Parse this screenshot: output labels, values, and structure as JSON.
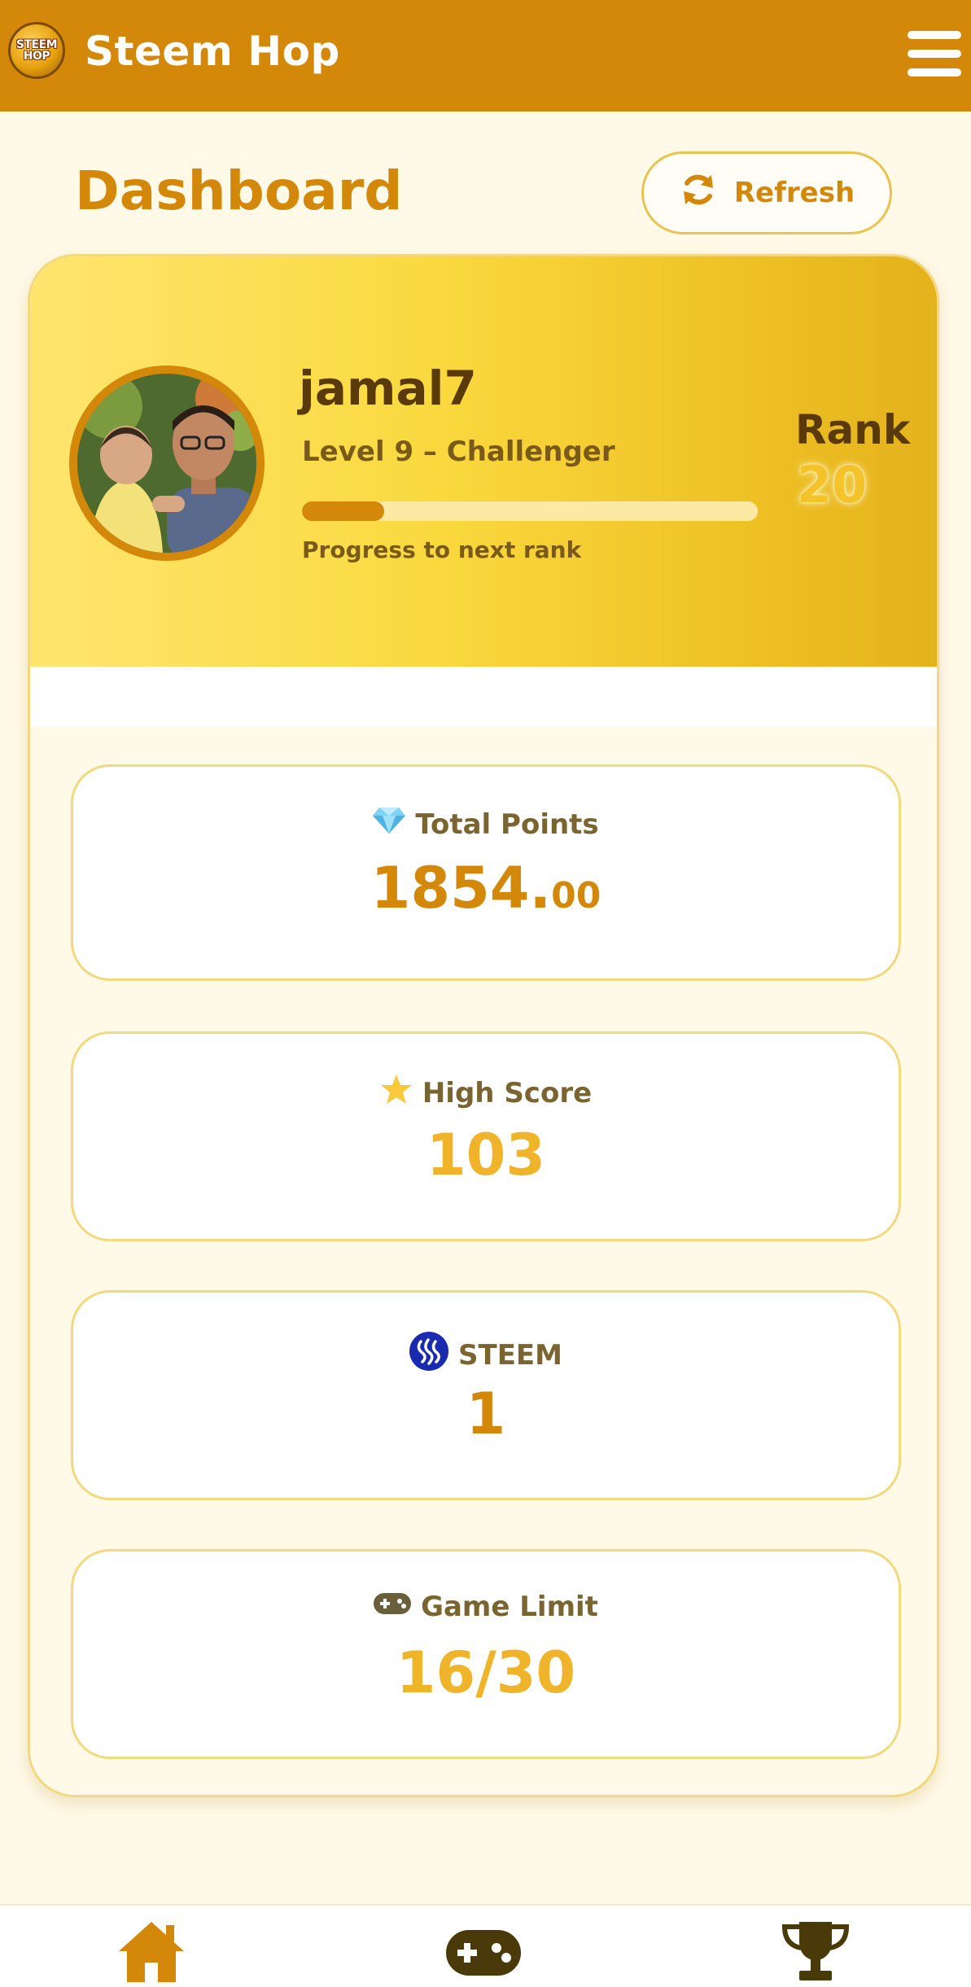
{
  "app": {
    "title": "Steem Hop",
    "logo_text_top": "STEEM",
    "logo_text_bottom": "HOP"
  },
  "page": {
    "title": "Dashboard",
    "refresh_label": "Refresh"
  },
  "profile": {
    "username": "jamal7",
    "level": "Level 9 – Challenger",
    "progress_label": "Progress to next rank",
    "progress_fraction": 0.18,
    "rank_label": "Rank",
    "rank_value": "20"
  },
  "stats": {
    "total_points": {
      "label": "Total Points",
      "value_main": "1854.",
      "value_decimal": "00",
      "icon": "gem-icon"
    },
    "high_score": {
      "label": "High Score",
      "value": "103",
      "icon": "star-icon"
    },
    "steem": {
      "label": "STEEM",
      "value": "1",
      "icon": "steem-icon"
    },
    "game_limit": {
      "label": "Game Limit",
      "value": "16/30",
      "icon": "gamepad-icon"
    }
  },
  "nav": {
    "items": [
      {
        "icon": "home-icon",
        "active": true
      },
      {
        "icon": "gamepad-icon",
        "active": false
      },
      {
        "icon": "trophy-icon",
        "active": false
      }
    ]
  },
  "colors": {
    "header": "#D4880A",
    "accent": "#D4880A",
    "gold": "#F4C32A",
    "background": "#FFF9E8",
    "steem_blue": "#1A2BB0"
  }
}
